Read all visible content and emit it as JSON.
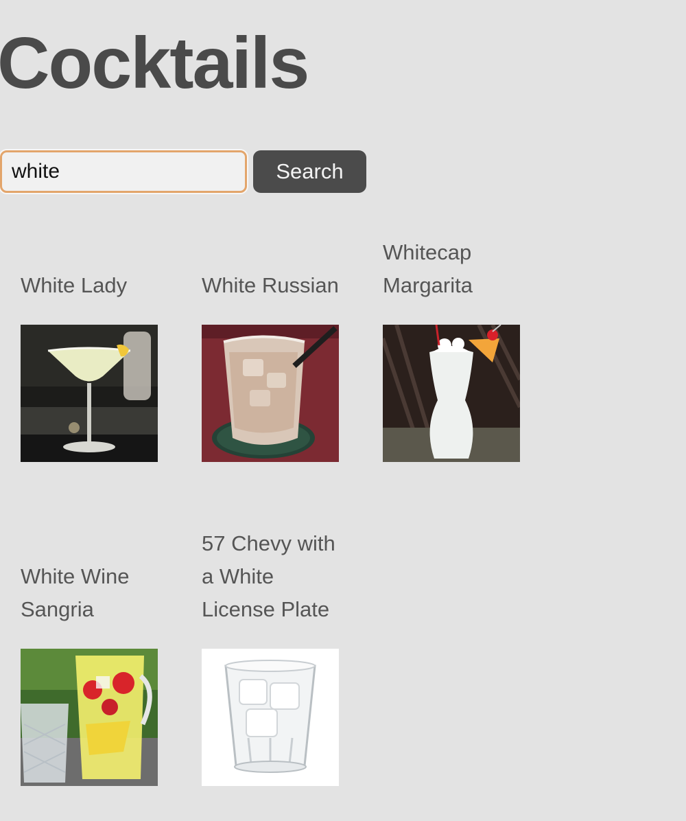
{
  "title": "Cocktails",
  "search": {
    "value": "white",
    "button_label": "Search"
  },
  "results": [
    {
      "name": "White Lady",
      "image": "white-lady-photo"
    },
    {
      "name": "White Russian",
      "image": "white-russian-photo"
    },
    {
      "name": "Whitecap Margarita",
      "image": "whitecap-margarita-photo"
    },
    {
      "name": "White Wine Sangria",
      "image": "white-wine-sangria-photo"
    },
    {
      "name": "57 Chevy with a White License Plate",
      "image": "57-chevy-photo"
    }
  ],
  "colors": {
    "background": "#e3e3e3",
    "text": "#4a4a4a",
    "input_focus_border": "#e3a56b",
    "button_bg": "#4b4b4b"
  }
}
